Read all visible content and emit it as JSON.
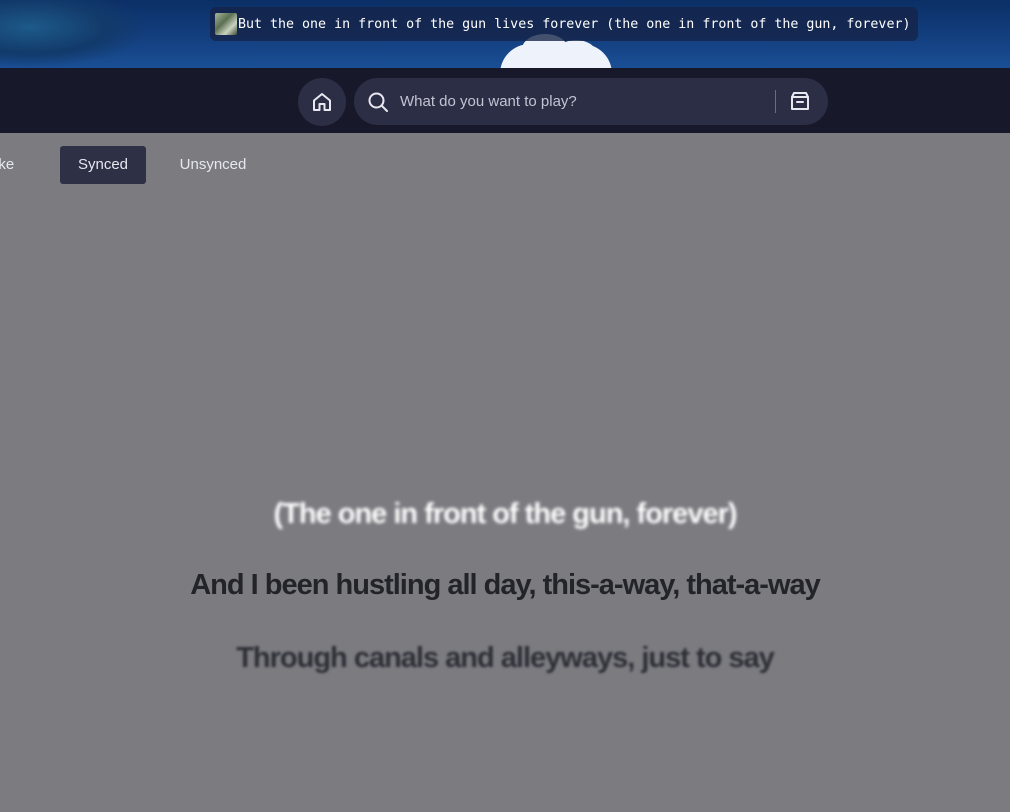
{
  "now_playing": {
    "text": "But the one in front of the gun lives forever (the one in front of the gun, forever)"
  },
  "header": {
    "home_icon": "home-icon",
    "search": {
      "placeholder": "What do you want to play?",
      "icon": "search-icon"
    },
    "browse_icon": "browse-icon"
  },
  "tabs": [
    {
      "label": "oke"
    },
    {
      "label": "Synced",
      "active": true
    },
    {
      "label": "Unsynced"
    }
  ],
  "lyrics": {
    "lines": [
      "(The one in front of the gun, forever)",
      "And I been hustling all day, this-a-way, that-a-way",
      "Through canals and alleyways, just to say"
    ]
  },
  "colors": {
    "header_bg": "#17182a",
    "control_bg": "#2c2e46",
    "lyrics_bg": "#7b7b80",
    "active_lyric": "#23242a"
  }
}
